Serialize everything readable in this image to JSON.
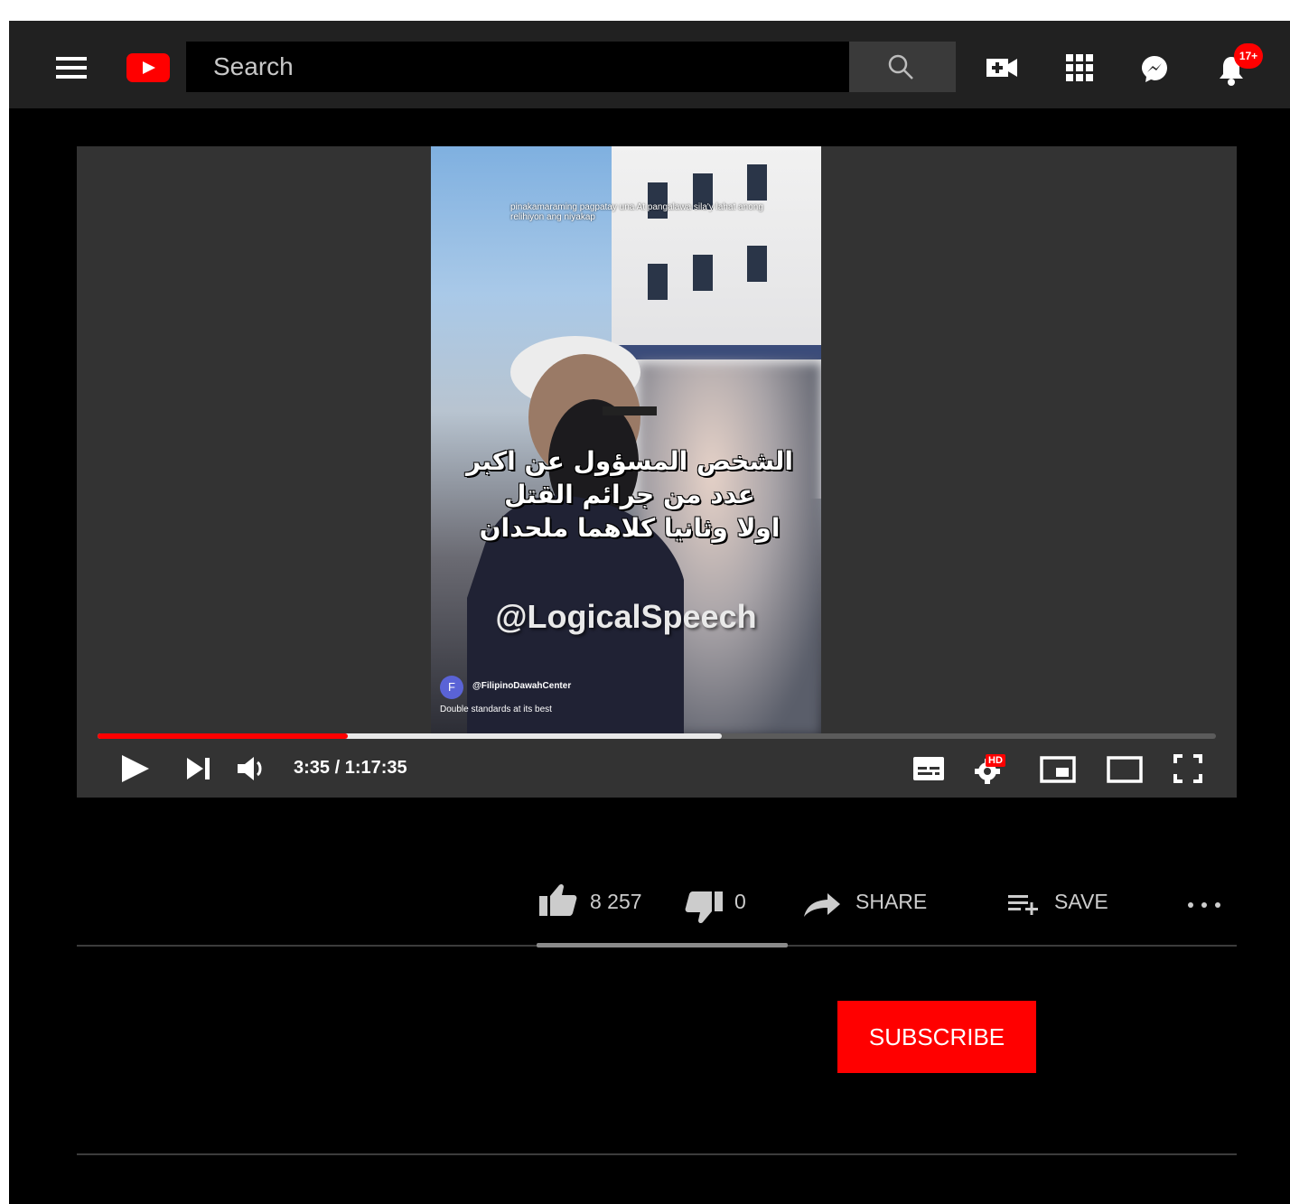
{
  "header": {
    "search_placeholder": "Search",
    "notification_count": "17+"
  },
  "video": {
    "overlay_caption": "pinakamaraming pagpatay una At pangalawa sila'y lahat anong relihiyon ang niyakap",
    "arabic_lines": [
      "الشخص المسؤول عن اكبر",
      "عدد من جرائم القتل",
      "اولا وثانيا كلاهما ملحدان"
    ],
    "watermark": "@LogicalSpeech",
    "channel_initial": "F",
    "channel_handle": "@FilipinoDawahCenter",
    "description": "Double standards at its best"
  },
  "player": {
    "current_time": "3:35",
    "duration": "1:17:35",
    "time_display": "3:35 / 1:17:35",
    "played_fraction": 0.224,
    "buffered_fraction": 0.558,
    "hd_badge": "HD"
  },
  "actions": {
    "like_count": "8 257",
    "dislike_count": "0",
    "share_label": "SHARE",
    "save_label": "SAVE",
    "more_label": "..."
  },
  "subscribe_label": "SUBSCRIBE",
  "colors": {
    "brand_red": "#ff0000",
    "topbar": "#212121",
    "player_bg": "#333333"
  },
  "icons": [
    "menu-icon",
    "youtube-logo-icon",
    "search-icon",
    "create-video-icon",
    "apps-grid-icon",
    "messages-icon",
    "notifications-bell-icon",
    "play-icon",
    "next-icon",
    "volume-icon",
    "subtitles-icon",
    "settings-gear-icon",
    "miniplayer-icon",
    "theater-mode-icon",
    "fullscreen-icon",
    "thumbs-up-icon",
    "thumbs-down-icon",
    "share-arrow-icon",
    "save-playlist-icon",
    "more-dots-icon"
  ]
}
